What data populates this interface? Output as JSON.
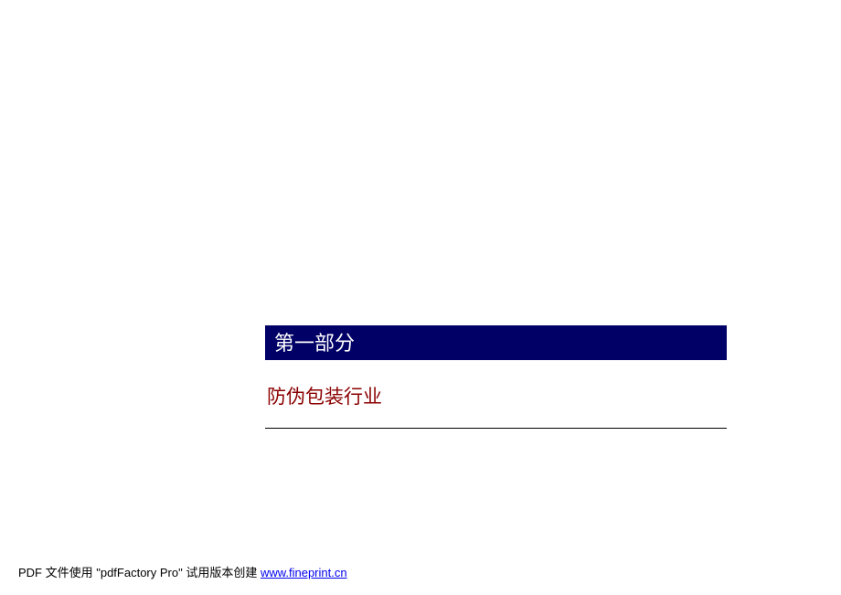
{
  "section": {
    "header": "第一部分",
    "title": "防伪包装行业"
  },
  "footer": {
    "prefix": "PDF 文件使用 \"pdfFactory Pro\" 试用版本创建 ",
    "link_text": "www.fineprint.cn"
  }
}
